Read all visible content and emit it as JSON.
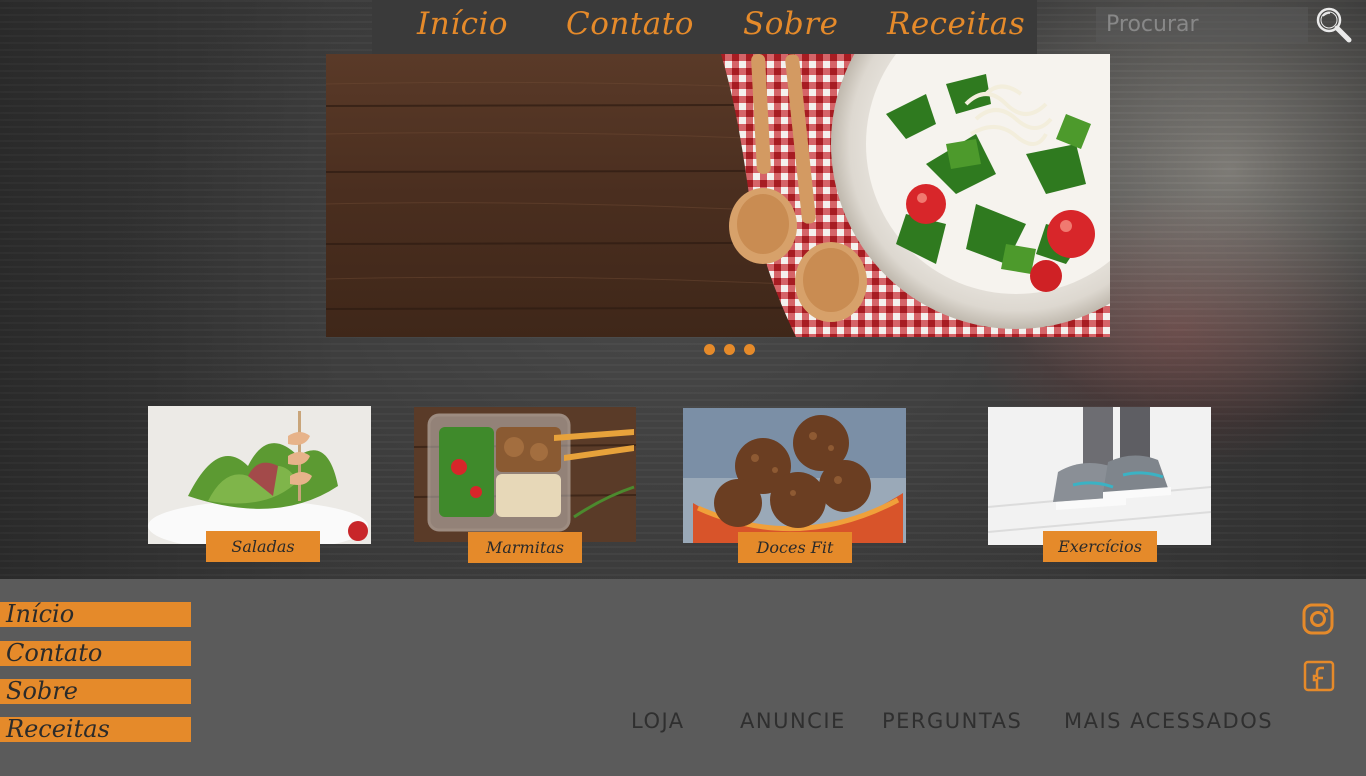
{
  "nav": {
    "items": [
      {
        "label": "Início"
      },
      {
        "label": "Contato"
      },
      {
        "label": "Sobre"
      },
      {
        "label": "Receitas"
      }
    ]
  },
  "search": {
    "placeholder": "Procurar",
    "icon": "magnifier-icon"
  },
  "carousel": {
    "dots_count": 3,
    "image": "wooden-spoons-and-arugula-salad-plate"
  },
  "categories": [
    {
      "label": "Saladas",
      "image": "salad-with-skewer"
    },
    {
      "label": "Marmitas",
      "image": "meal-prep-container"
    },
    {
      "label": "Doces Fit",
      "image": "protein-balls-dish"
    },
    {
      "label": "Exercícios",
      "image": "running-sneakers"
    }
  ],
  "footer": {
    "links": [
      {
        "label": "Início"
      },
      {
        "label": "Contato"
      },
      {
        "label": "Sobre"
      },
      {
        "label": "Receitas"
      }
    ],
    "menu": [
      {
        "label": "LOJA"
      },
      {
        "label": "ANUNCIE"
      },
      {
        "label": "PERGUNTAS"
      },
      {
        "label": "MAIS ACESSADOS"
      }
    ],
    "social": [
      {
        "icon": "instagram-icon"
      },
      {
        "icon": "facebook-icon"
      }
    ]
  },
  "colors": {
    "accent": "#e58a2a",
    "nav_bg": "#3a3a3a",
    "footer_bg": "#5b5b5b"
  }
}
